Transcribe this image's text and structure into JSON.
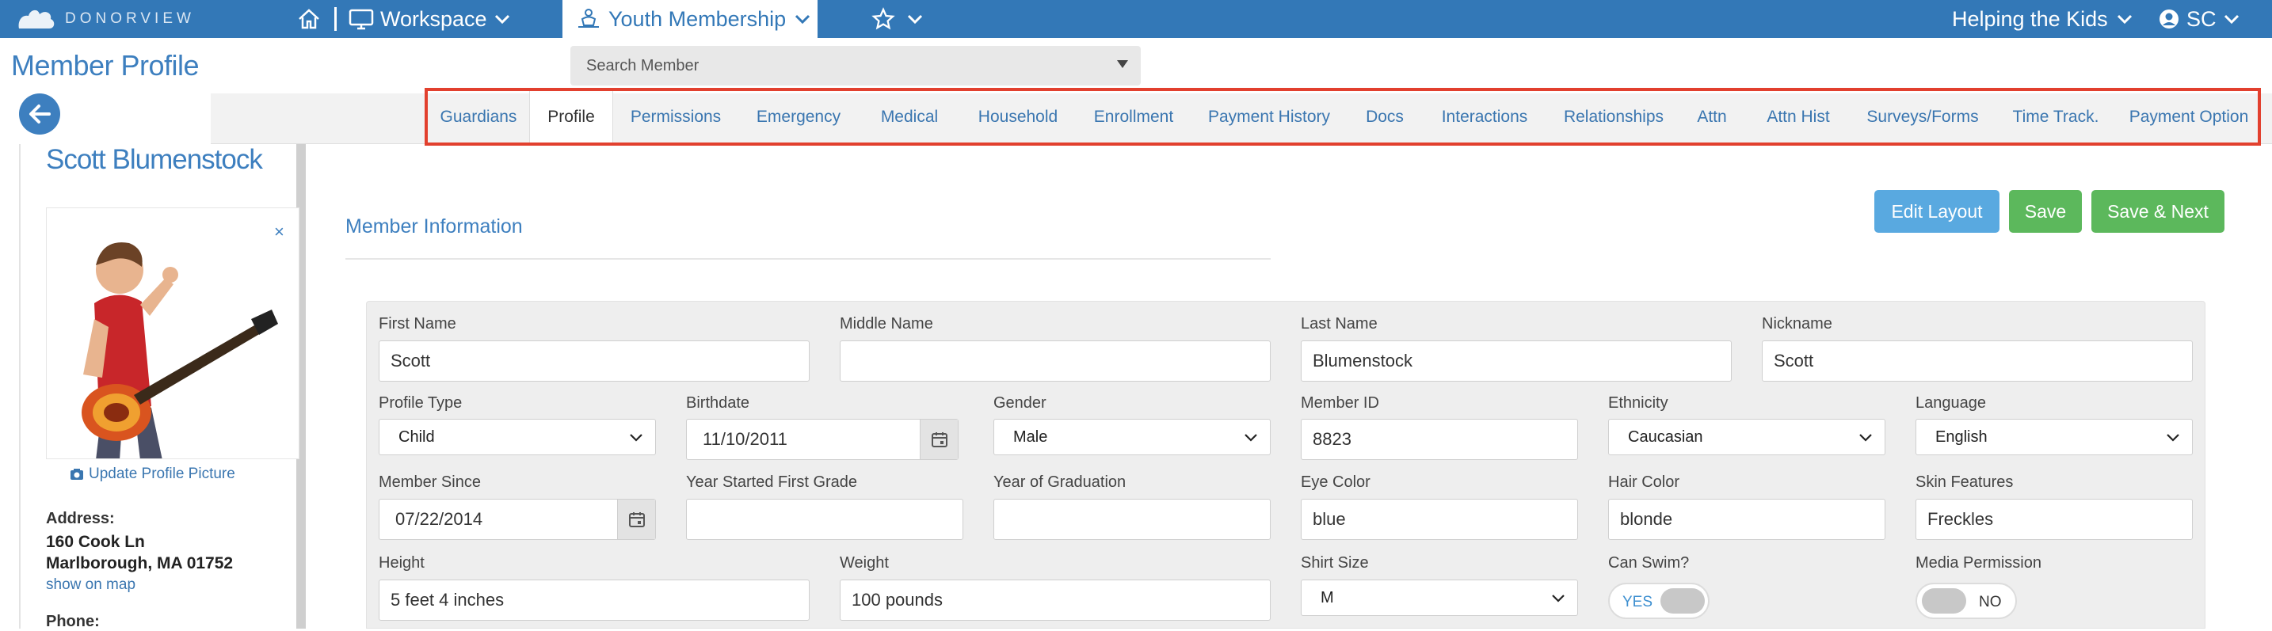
{
  "topnav": {
    "logo_text": "DONORVIEW",
    "workspace_label": "Workspace",
    "youth_label": "Youth Membership",
    "org_label": "Helping the Kids",
    "user_initials": "SC",
    "bar_color": "#3378b7"
  },
  "header": {
    "page_title": "Member Profile",
    "search_placeholder": "Search Member"
  },
  "tabs": [
    {
      "label": "Guardians",
      "active": false
    },
    {
      "label": "Profile",
      "active": true
    },
    {
      "label": "Permissions",
      "active": false
    },
    {
      "label": "Emergency",
      "active": false
    },
    {
      "label": "Medical",
      "active": false
    },
    {
      "label": "Household",
      "active": false
    },
    {
      "label": "Enrollment",
      "active": false
    },
    {
      "label": "Payment History",
      "active": false
    },
    {
      "label": "Docs",
      "active": false
    },
    {
      "label": "Interactions",
      "active": false
    },
    {
      "label": "Relationships",
      "active": false
    },
    {
      "label": "Attn",
      "active": false
    },
    {
      "label": "Attn Hist",
      "active": false
    },
    {
      "label": "Surveys/Forms",
      "active": false
    },
    {
      "label": "Time Track.",
      "active": false
    },
    {
      "label": "Payment Option",
      "active": false
    }
  ],
  "sidebar": {
    "member_name": "Scott Blumenstock",
    "close_symbol": "×",
    "update_picture": "Update Profile Picture",
    "address_label": "Address:",
    "address_line1": "160 Cook Ln",
    "address_line2": "Marlborough, MA 01752",
    "map_link": "show on map",
    "phone_label": "Phone:"
  },
  "main": {
    "section_title": "Member Information",
    "edit_layout": "Edit Layout",
    "save": "Save",
    "save_next": "Save & Next",
    "button_blue": "#59a9e0",
    "button_green": "#5cb85c"
  },
  "form": {
    "first_name": {
      "label": "First Name",
      "value": "Scott"
    },
    "middle_name": {
      "label": "Middle Name",
      "value": ""
    },
    "last_name": {
      "label": "Last Name",
      "value": "Blumenstock"
    },
    "nickname": {
      "label": "Nickname",
      "value": "Scott"
    },
    "profile_type": {
      "label": "Profile Type",
      "value": "Child"
    },
    "birthdate": {
      "label": "Birthdate",
      "value": "11/10/2011"
    },
    "gender": {
      "label": "Gender",
      "value": "Male"
    },
    "member_id": {
      "label": "Member ID",
      "value": "8823"
    },
    "ethnicity": {
      "label": "Ethnicity",
      "value": "Caucasian"
    },
    "language": {
      "label": "Language",
      "value": "English"
    },
    "member_since": {
      "label": "Member Since",
      "value": "07/22/2014"
    },
    "year_started": {
      "label": "Year Started First Grade",
      "value": ""
    },
    "year_graduation": {
      "label": "Year of Graduation",
      "value": ""
    },
    "eye_color": {
      "label": "Eye Color",
      "value": "blue"
    },
    "hair_color": {
      "label": "Hair Color",
      "value": "blonde"
    },
    "skin_features": {
      "label": "Skin Features",
      "value": "Freckles"
    },
    "height": {
      "label": "Height",
      "value": "5 feet 4 inches"
    },
    "weight": {
      "label": "Weight",
      "value": "100 pounds"
    },
    "shirt_size": {
      "label": "Shirt Size",
      "value": "M"
    },
    "can_swim": {
      "label": "Can Swim?",
      "state": "YES",
      "on": true
    },
    "media_permission": {
      "label": "Media Permission",
      "state": "NO",
      "on": false
    }
  }
}
